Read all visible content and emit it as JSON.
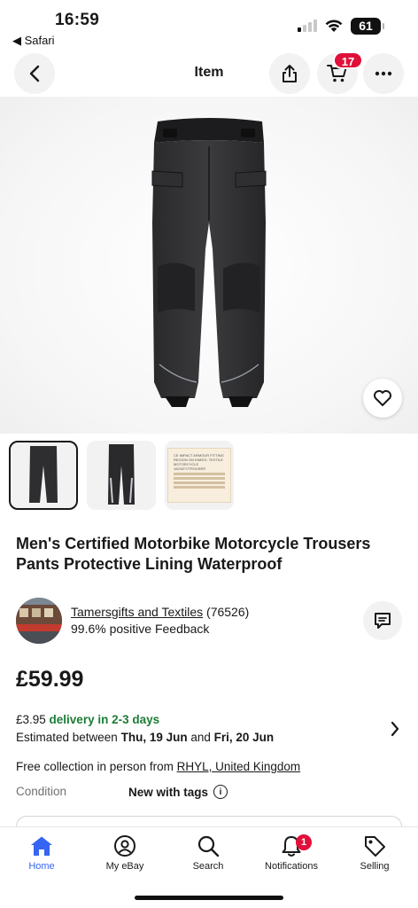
{
  "status_bar": {
    "time": "16:59",
    "back_app": "◀ Safari",
    "battery": "61"
  },
  "nav": {
    "title": "Item",
    "cart_count": "17",
    "icons": [
      "chevron-left-icon",
      "share-icon",
      "cart-icon",
      "more-icon"
    ]
  },
  "product": {
    "title": "Men's Certified Motorbike Motorcycle Trousers Pants Protective Lining Waterproof",
    "thumbnail_label_text": "CE IMPACT ARMOUR FITTING REGION ON KNEES. TEXTILE MOTORCYCLE JACKET/TROUSER"
  },
  "seller": {
    "name": "Tamersgifts and Textiles",
    "count": " (76526)",
    "feedback": "99.6% positive Feedback"
  },
  "price": "£59.99",
  "delivery": {
    "cost": "£3.95 ",
    "speed": "delivery in 2-3 days",
    "est_prefix": "Estimated between ",
    "date_from": "Thu, 19 Jun",
    "and": " and ",
    "date_to": "Fri, 20 Jun"
  },
  "collection": {
    "text": "Free collection in person from ",
    "location": "RHYL, United Kingdom"
  },
  "condition": {
    "label": "Condition",
    "value": "New with tags"
  },
  "tabs": [
    {
      "label": "Home",
      "icon": "home-icon"
    },
    {
      "label": "My eBay",
      "icon": "user-icon"
    },
    {
      "label": "Search",
      "icon": "search-icon"
    },
    {
      "label": "Notifications",
      "icon": "bell-icon",
      "badge": "1"
    },
    {
      "label": "Selling",
      "icon": "tag-icon"
    }
  ],
  "colors": {
    "accent": "#3665f3",
    "badge": "#e0103a",
    "delivery_green": "#1b7d35"
  }
}
